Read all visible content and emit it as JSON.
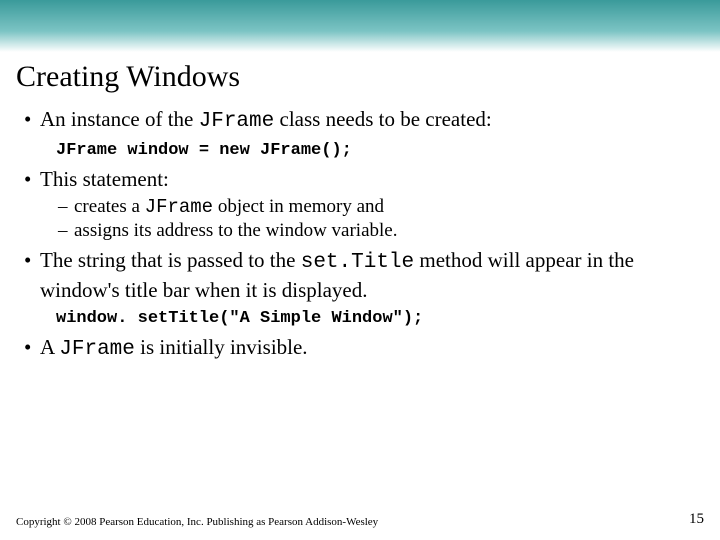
{
  "title": "Creating Windows",
  "bullets": {
    "b1_pre": "An instance of the ",
    "b1_code": "JFrame",
    "b1_post": " class needs to be created:",
    "code1": "JFrame window = new JFrame();",
    "b2": "This statement:",
    "sub1_pre": "creates a ",
    "sub1_code": "JFrame",
    "sub1_post": " object in memory and",
    "sub2": "assigns its address to the window variable.",
    "b3_pre": "The string that is passed to the ",
    "b3_code": "set.Title",
    "b3_post": " method will appear in the window's title bar when it is displayed.",
    "code2": "window. setTitle(\"A Simple Window\");",
    "b4_pre": "A ",
    "b4_code": "JFrame",
    "b4_post": " is initially invisible."
  },
  "footer": {
    "copyright": "Copyright © 2008 Pearson Education, Inc. Publishing as Pearson Addison-Wesley",
    "page": "15"
  }
}
